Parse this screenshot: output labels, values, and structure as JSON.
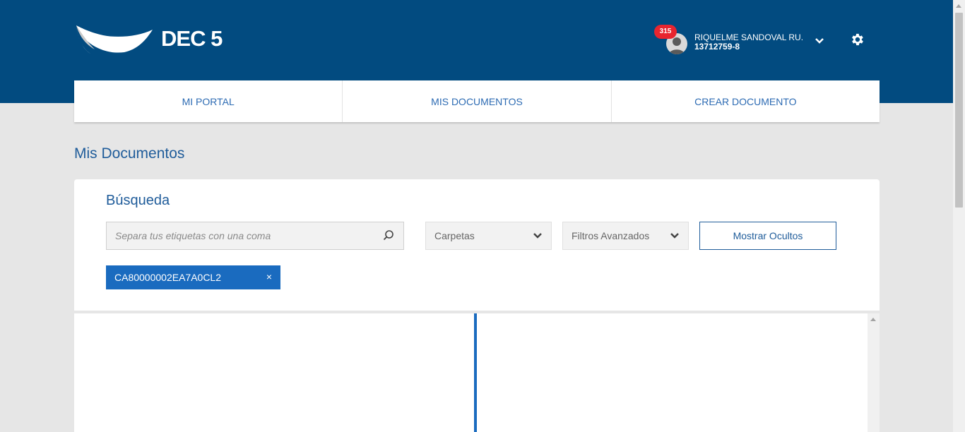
{
  "header": {
    "logo_text": "DEC 5",
    "notification_count": "315",
    "user_name": "RIQUELME SANDOVAL RU...",
    "user_id": "13712759-8"
  },
  "nav": {
    "items": [
      {
        "label": "MI PORTAL"
      },
      {
        "label": "MIS DOCUMENTOS"
      },
      {
        "label": "CREAR DOCUMENTO"
      }
    ]
  },
  "page": {
    "title": "Mis Documentos"
  },
  "search": {
    "title": "Búsqueda",
    "placeholder": "Separa tus etiquetas con una coma",
    "folders_label": "Carpetas",
    "advanced_filters_label": "Filtros Avanzados",
    "show_hidden_label": "Mostrar Ocultos",
    "tag_value": "CA80000002EA7A0CL2",
    "tag_close": "×"
  },
  "colors": {
    "header_bg": "#024b80",
    "accent": "#1a6bbf",
    "badge": "#e8252f"
  }
}
